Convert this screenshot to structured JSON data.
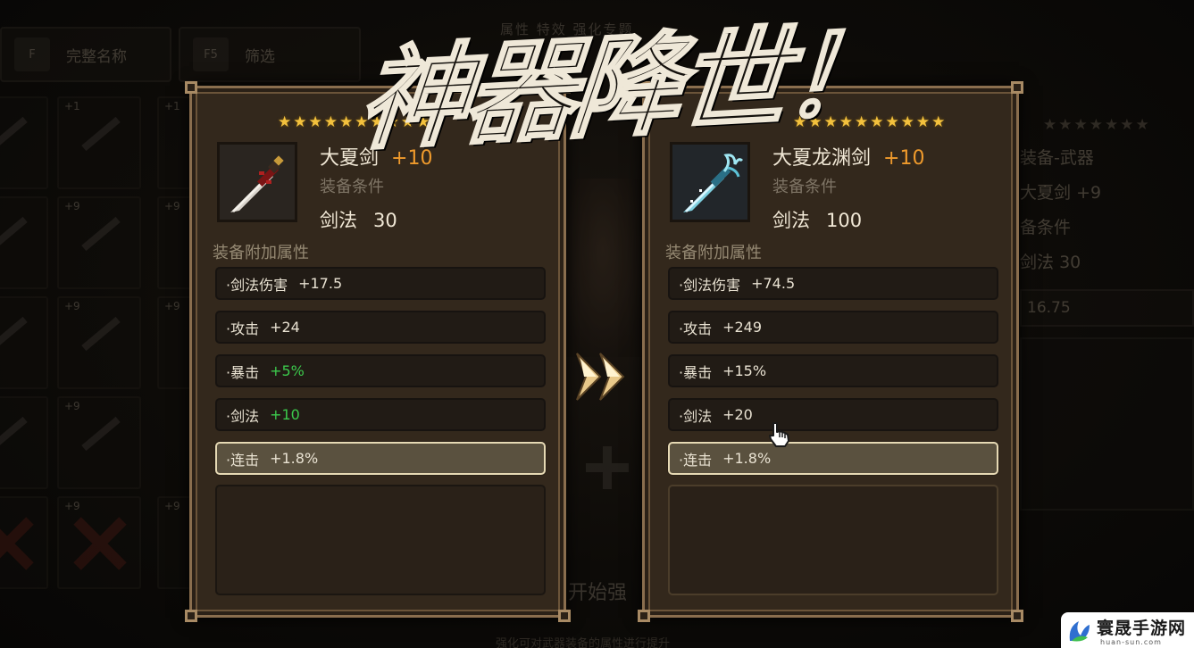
{
  "background": {
    "key_full_name": {
      "key": "F",
      "label": "完整名称"
    },
    "key_filter": {
      "key": "F5",
      "label": "筛选"
    },
    "tabs_text": "属性  特效  强化专题",
    "slot_levels": [
      "+1",
      "+1",
      "+9",
      "+9",
      "+9",
      "+9",
      "+9",
      "+9",
      "+9",
      "+9"
    ],
    "right_panel": {
      "stars": "★★★★★★★",
      "category": "装备-武器",
      "item_name": "大夏剑",
      "item_plus": "+9",
      "requirement_label": "备条件",
      "stat_label": "剑法",
      "stat_value": "30",
      "box_value": "16.75"
    },
    "bottom_text": "开始强",
    "footer_text": "强化可对武器装备的属性进行提升"
  },
  "banner": {
    "text": "神器降世！"
  },
  "cards": [
    {
      "stars": "★★★★★★★★★★",
      "name": "大夏剑",
      "plus": "+10",
      "requirement_label": "装备条件",
      "stat_label": "剑法",
      "stat_value": "30",
      "bonus_header": "装备附加属性",
      "bonuses": [
        {
          "label": "·剑法伤害",
          "value": "+17.5",
          "color": "#e9e2d2"
        },
        {
          "label": "·攻击",
          "value": "+24",
          "color": "#e9e2d2"
        },
        {
          "label": "·暴击",
          "value": "+5%",
          "color": "#3cc94c"
        },
        {
          "label": "·剑法",
          "value": "+10",
          "color": "#3cc94c"
        },
        {
          "label": "·连击",
          "value": "+1.8%",
          "color": "#e9e2d2",
          "selected": true
        }
      ]
    },
    {
      "stars": "★★★★★★★★★★",
      "name": "大夏龙渊剑",
      "plus": "+10",
      "requirement_label": "装备条件",
      "stat_label": "剑法",
      "stat_value": "100",
      "bonus_header": "装备附加属性",
      "bonuses": [
        {
          "label": "·剑法伤害",
          "value": "+74.5",
          "color": "#e9e2d2"
        },
        {
          "label": "·攻击",
          "value": "+249",
          "color": "#e9e2d2"
        },
        {
          "label": "·暴击",
          "value": "+15%",
          "color": "#e9e2d2"
        },
        {
          "label": "·剑法",
          "value": "+20",
          "color": "#e9e2d2"
        },
        {
          "label": "·连击",
          "value": "+1.8%",
          "color": "#e9e2d2",
          "selected": true
        }
      ]
    }
  ],
  "colors": {
    "star": "#f3c13d",
    "plus_level": "#ef9a2c",
    "bonus_green": "#3cc94c",
    "card_frame": "#8a6e4e"
  },
  "icons": {
    "left_item": "sword-icon",
    "right_item": "dragon-sword-icon",
    "transition": "fast-forward-icon",
    "cursor": "hand-pointer-icon"
  },
  "watermark": {
    "title": "寰晟手游网",
    "url": "huan-sun.com"
  }
}
